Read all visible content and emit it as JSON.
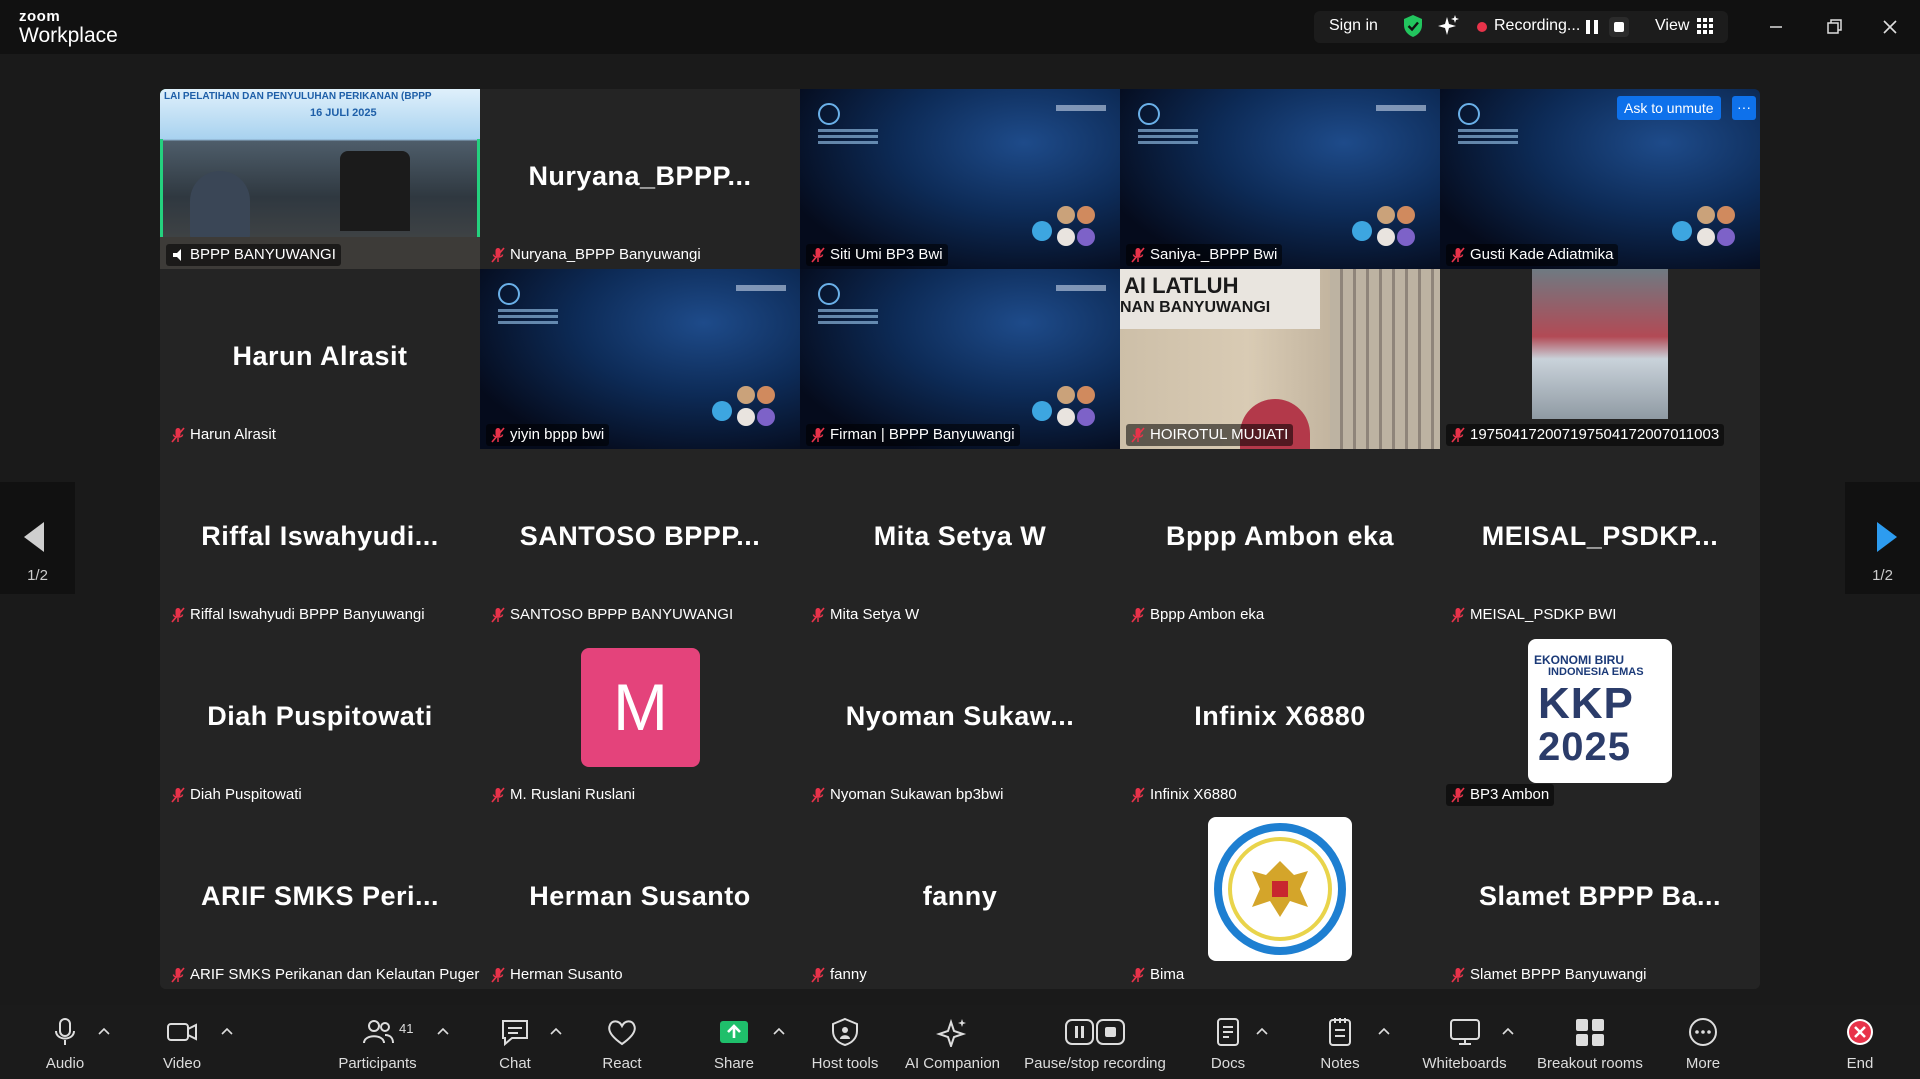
{
  "app": {
    "brand_small": "zoom",
    "brand_name": "Workplace"
  },
  "titlebar": {
    "sign_in": "Sign in",
    "recording": "Recording...",
    "view": "View"
  },
  "gallery": {
    "page": "1/2",
    "ask_to_unmute": "Ask to unmute",
    "more_dots": "···",
    "banner_text": "LAI PELATIHAN DAN PENYULUHAN PERIKANAN (BPPP",
    "banner_date": "16 JULI 2025",
    "wall_text_1": "AI  LATLUH",
    "wall_text_2": "NAN  BANYUWANGI",
    "kkp_line1": "EKONOMI BIRU",
    "kkp_line2": "INDONESIA EMAS",
    "kkp_big": "KKP",
    "kkp_year": "2025",
    "tiles": [
      {
        "big": "",
        "label": "BPPP BANYUWANGI"
      },
      {
        "big": "Nuryana_BPPP...",
        "label": "Nuryana_BPPP Banyuwangi"
      },
      {
        "big": "",
        "label": "Siti Umi BP3 Bwi"
      },
      {
        "big": "",
        "label": "Saniya-_BPPP Bwi"
      },
      {
        "big": "",
        "label": "Gusti Kade Adiatmika"
      },
      {
        "big": "Harun Alrasit",
        "label": "Harun Alrasit"
      },
      {
        "big": "",
        "label": "yiyin bppp bwi"
      },
      {
        "big": "",
        "label": "Firman | BPPP Banyuwangi"
      },
      {
        "big": "",
        "label": "HOIROTUL MUJIATI"
      },
      {
        "big": "",
        "label": "197504172007197504172007011003"
      },
      {
        "big": "Riffal  Iswahyudi...",
        "label": "Riffal Iswahyudi BPPP Banyuwangi"
      },
      {
        "big": "SANTOSO  BPPP...",
        "label": "SANTOSO BPPP BANYUWANGI"
      },
      {
        "big": "Mita Setya W",
        "label": "Mita Setya W"
      },
      {
        "big": "Bppp Ambon eka",
        "label": "Bppp Ambon eka"
      },
      {
        "big": "MEISAL_PSDKP...",
        "label": "MEISAL_PSDKP BWI"
      },
      {
        "big": "Diah Puspitowati",
        "label": "Diah Puspitowati"
      },
      {
        "big": "M",
        "label": "M. Ruslani Ruslani"
      },
      {
        "big": "Nyoman  Sukaw...",
        "label": "Nyoman Sukawan bp3bwi"
      },
      {
        "big": "Infinix X6880",
        "label": "Infinix X6880"
      },
      {
        "big": "",
        "label": "BP3 Ambon"
      },
      {
        "big": "ARIF  SMKS  Peri...",
        "label": "ARIF SMKS Perikanan dan Kelautan Puger"
      },
      {
        "big": "Herman Susanto",
        "label": "Herman Susanto"
      },
      {
        "big": "fanny",
        "label": "fanny"
      },
      {
        "big": "",
        "label": "Bima"
      },
      {
        "big": "Slamet  BPPP  Ba...",
        "label": "Slamet BPPP Banyuwangi"
      }
    ]
  },
  "toolbar": {
    "audio": "Audio",
    "video": "Video",
    "participants": "Participants",
    "participants_count": "41",
    "chat": "Chat",
    "react": "React",
    "share": "Share",
    "host_tools": "Host tools",
    "ai_companion": "AI Companion",
    "pause_stop": "Pause/stop recording",
    "docs": "Docs",
    "notes": "Notes",
    "whiteboards": "Whiteboards",
    "breakout_rooms": "Breakout rooms",
    "more": "More",
    "end": "End"
  },
  "colors": {
    "active_speaker": "#24d17e",
    "share_green": "#1fbf6b",
    "end_red": "#e8334a",
    "avatar_pink": "#e4437b",
    "unmute_blue": "#0e71eb"
  }
}
